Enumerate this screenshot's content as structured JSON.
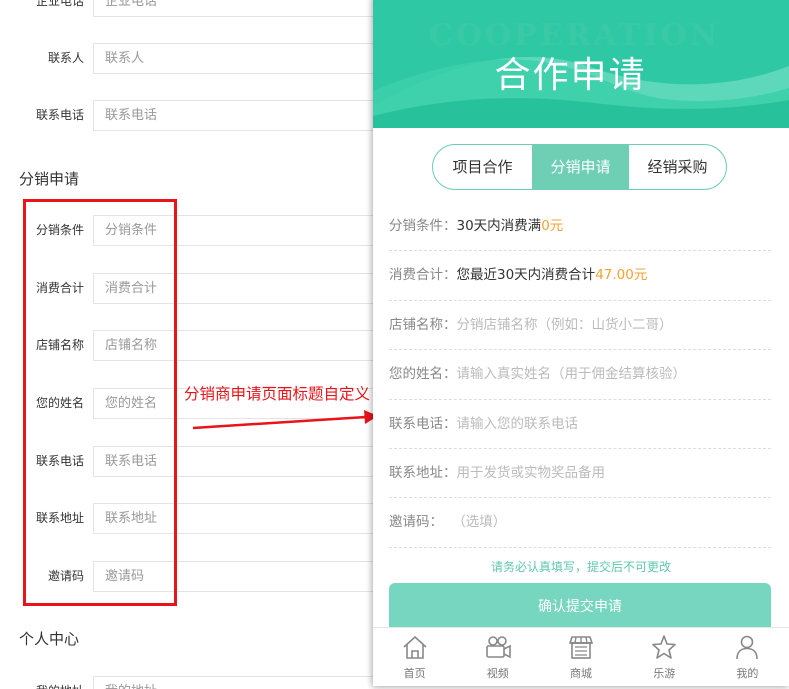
{
  "left_form": {
    "top_partial": {
      "label": "企业电话",
      "placeholder": "企业电话"
    },
    "contact_rows": [
      {
        "label": "联系人",
        "placeholder": "联系人"
      },
      {
        "label": "联系电话",
        "placeholder": "联系电话"
      }
    ],
    "distribution_section_title": "分销申请",
    "distribution_rows": [
      {
        "label": "分销条件",
        "placeholder": "分销条件"
      },
      {
        "label": "消费合计",
        "placeholder": "消费合计"
      },
      {
        "label": "店铺名称",
        "placeholder": "店铺名称"
      },
      {
        "label": "您的姓名",
        "placeholder": "您的姓名"
      },
      {
        "label": "联系电话",
        "placeholder": "联系电话"
      },
      {
        "label": "联系地址",
        "placeholder": "联系地址"
      },
      {
        "label": "邀请码",
        "placeholder": "邀请码"
      }
    ],
    "personal_section_title": "个人中心",
    "bottom_partial": {
      "label": "我的地址",
      "placeholder": "我的地址"
    }
  },
  "annotation": {
    "text": "分销商申请页面标题自定义",
    "color": "#e8141a"
  },
  "phone": {
    "banner": {
      "en_title": "COOPERATION",
      "cn_title": "合作申请",
      "colors": {
        "dark": "#2ec9a4",
        "light": "#5dd8bb"
      }
    },
    "tabs": [
      {
        "label": "项目合作",
        "active": false
      },
      {
        "label": "分销申请",
        "active": true
      },
      {
        "label": "经销采购",
        "active": false
      }
    ],
    "fields": {
      "condition": {
        "label": "分销条件：",
        "value_prefix": "30天内消费满",
        "value_highlight": "0元"
      },
      "total": {
        "label": "消费合计：",
        "value_prefix": "您最近30天内消费合计",
        "value_highlight": "47.00元"
      },
      "shop": {
        "label": "店铺名称：",
        "placeholder": "分销店铺名称（例如：山货小二哥）"
      },
      "name": {
        "label": "您的姓名：",
        "placeholder": "请输入真实姓名（用于佣金结算核验）"
      },
      "phone": {
        "label": "联系电话：",
        "placeholder": "请输入您的联系电话"
      },
      "address": {
        "label": "联系地址：",
        "placeholder": "用于发货或实物奖品备用"
      },
      "invite": {
        "label": "邀请码：",
        "placeholder": "（选填）"
      }
    },
    "notice": "请务必认真填写，提交后不可更改",
    "submit_label": "确认提交申请",
    "tabbar": [
      {
        "label": "首页",
        "icon": "home-icon"
      },
      {
        "label": "视频",
        "icon": "video-camera-icon"
      },
      {
        "label": "商城",
        "icon": "shop-icon"
      },
      {
        "label": "乐游",
        "icon": "star-icon"
      },
      {
        "label": "我的",
        "icon": "user-icon"
      }
    ],
    "accent_color": "#6fcfb5",
    "highlight_color": "#f7a032"
  }
}
